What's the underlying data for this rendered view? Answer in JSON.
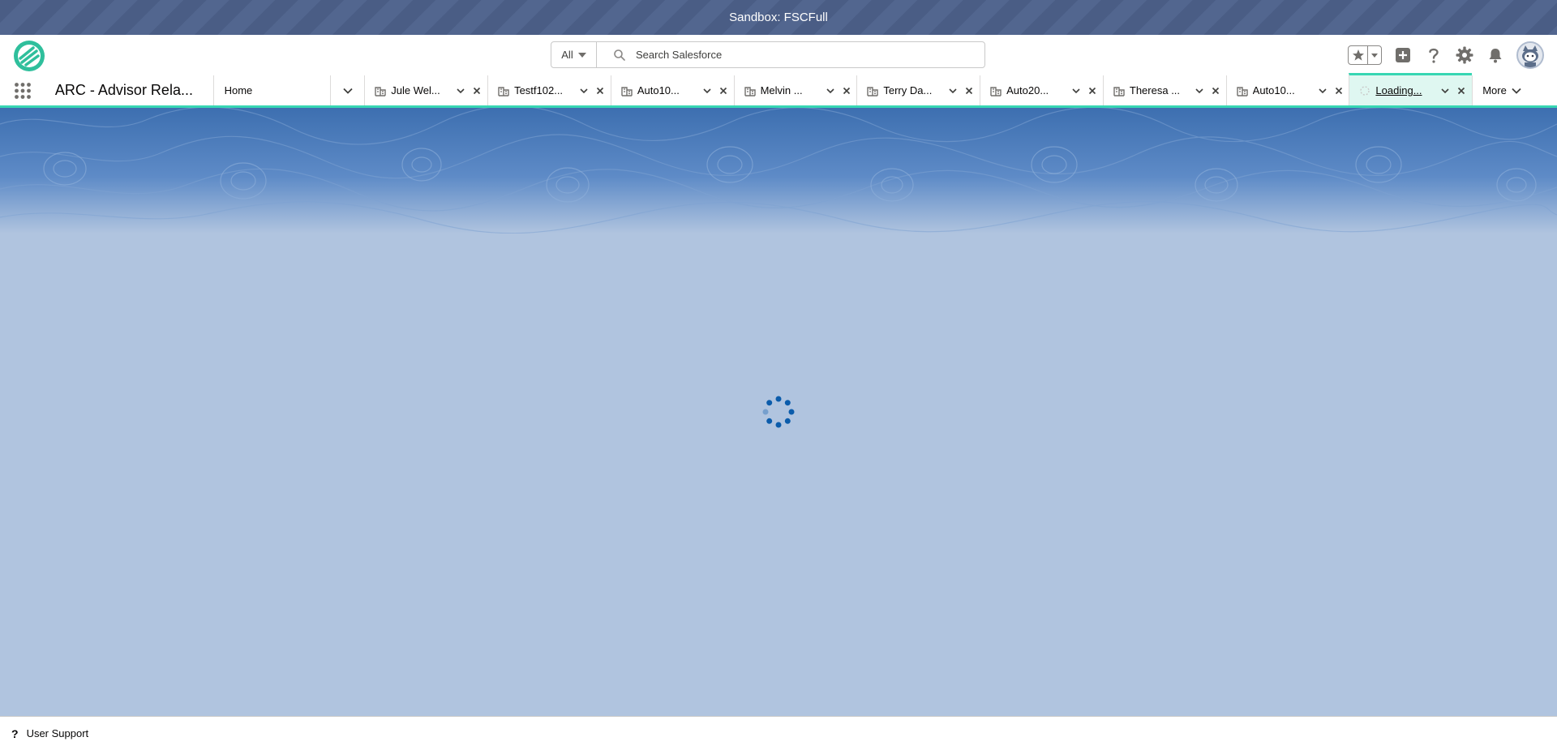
{
  "sandbox": {
    "label": "Sandbox: FSCFull"
  },
  "search": {
    "scope": "All",
    "placeholder": "Search Salesforce"
  },
  "app": {
    "name": "ARC - Advisor Rela..."
  },
  "nav": {
    "home_label": "Home",
    "more_label": "More",
    "tabs": [
      {
        "label": "Jule Wel..."
      },
      {
        "label": "Testf102..."
      },
      {
        "label": "Auto10..."
      },
      {
        "label": "Melvin ..."
      },
      {
        "label": "Terry Da..."
      },
      {
        "label": "Auto20..."
      },
      {
        "label": "Theresa ..."
      },
      {
        "label": "Auto10..."
      },
      {
        "label": "Loading..."
      }
    ]
  },
  "footer": {
    "label": "User Support"
  },
  "colors": {
    "sandbox_bg": "#4a5d85",
    "accent_teal": "#37d6b3",
    "page_bg": "#b0c4df",
    "spinner": "#0b5cab"
  },
  "icons": [
    "logo-icon",
    "search-icon",
    "star-icon",
    "add-icon",
    "help-icon",
    "gear-icon",
    "bell-icon",
    "app-launcher-icon",
    "record-icon",
    "chevron-down-icon",
    "close-icon",
    "spinner-icon"
  ]
}
